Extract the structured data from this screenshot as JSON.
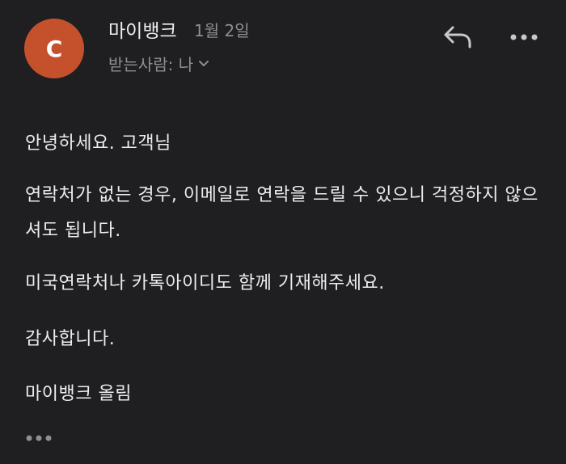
{
  "header": {
    "avatar_letter": "C",
    "avatar_color": "#c4512c",
    "sender_name": "마이뱅크",
    "date": "1월 2일",
    "recipient_label": "받는사람: 나",
    "recipient_expand_icon": "chevron-down-icon",
    "reply_icon": "reply-icon",
    "more_icon": "more-horizontal-icon"
  },
  "message": {
    "greeting": "안녕하세요. 고객님",
    "paragraph1": "연락처가 없는 경우, 이메일로 연락을 드릴 수 있으니 걱정하지 않으셔도 됩니다.",
    "paragraph2": "미국연락처나 카톡아이디도 함께 기재해주세요.",
    "thanks": "감사합니다.",
    "signature": "마이뱅크 올림"
  },
  "footer": {
    "show_trimmed_icon": "more-horizontal-icon"
  }
}
